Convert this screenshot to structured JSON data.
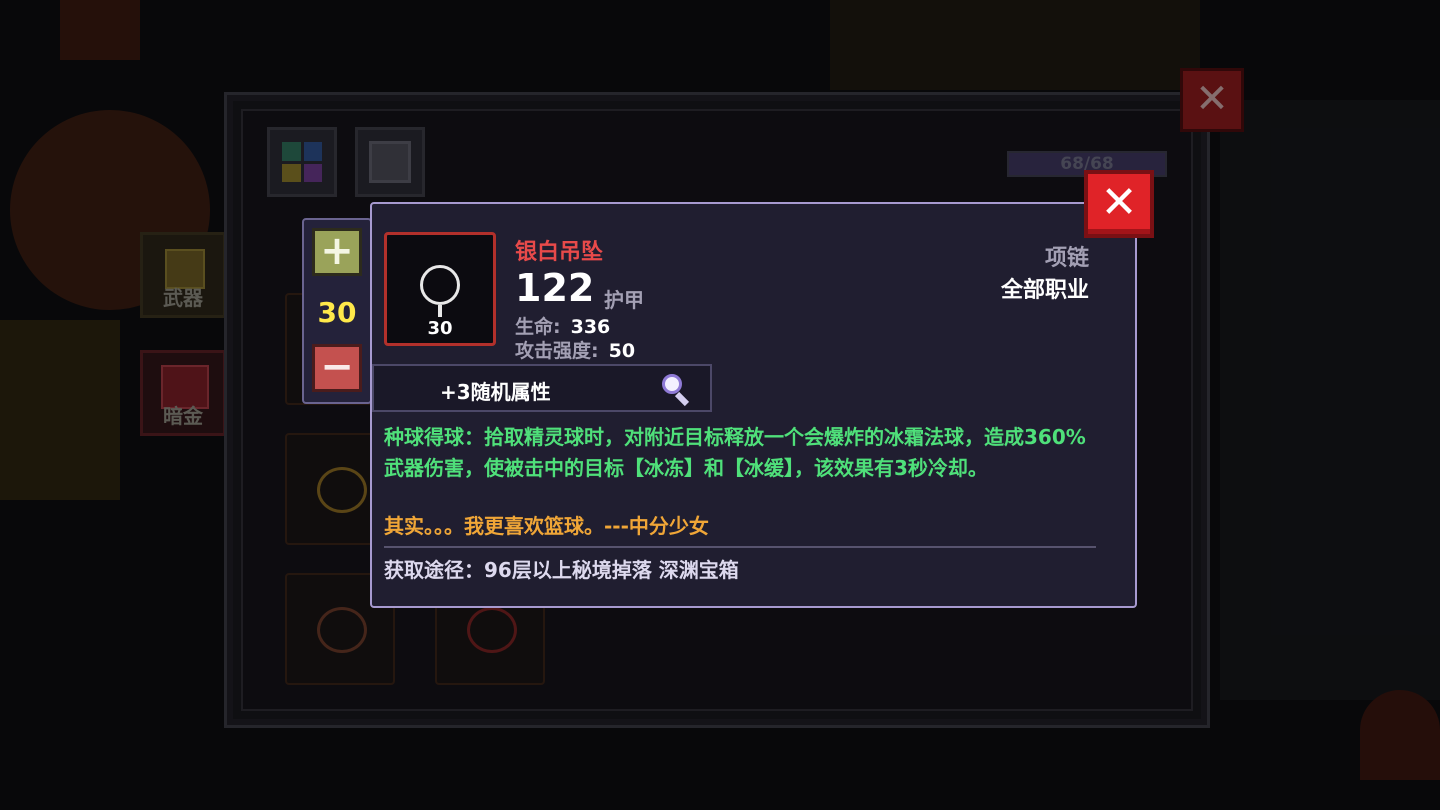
{
  "sidebar": {
    "weapon_label": "武器",
    "dark_gold_label": "暗金"
  },
  "inventory": {
    "hp_text": "68/68"
  },
  "stepper": {
    "plus": "+",
    "minus": "−",
    "quantity": "30"
  },
  "item": {
    "name": "银白吊坠",
    "level": "30",
    "armor_value": "122",
    "armor_label": "护甲",
    "stats": [
      {
        "label": "生命:",
        "value": "336"
      },
      {
        "label": "攻击强度:",
        "value": "50"
      }
    ],
    "slot_type": "项链",
    "class_requirement": "全部职业",
    "random_attributes": "+3随机属性",
    "description": "种球得球：拾取精灵球时，对附近目标释放一个会爆炸的冰霜法球，造成360%武器伤害，使被击中的目标【冰冻】和【冰缓】，该效果有3秒冷却。",
    "flavor_text": "其实。。。我更喜欢篮球。---中分少女",
    "source": "获取途径：96层以上秘境掉落 深渊宝箱"
  },
  "colors": {
    "item_name": "#e84a4a",
    "description": "#4fe07a",
    "flavor": "#f0a637",
    "quantity": "#ffe94a",
    "close_button": "#e02328"
  },
  "icons": [
    "close-icon",
    "plus-icon",
    "minus-icon",
    "magnifier-icon",
    "pendant-icon",
    "bag-tab-icon",
    "armor-tab-icon"
  ]
}
